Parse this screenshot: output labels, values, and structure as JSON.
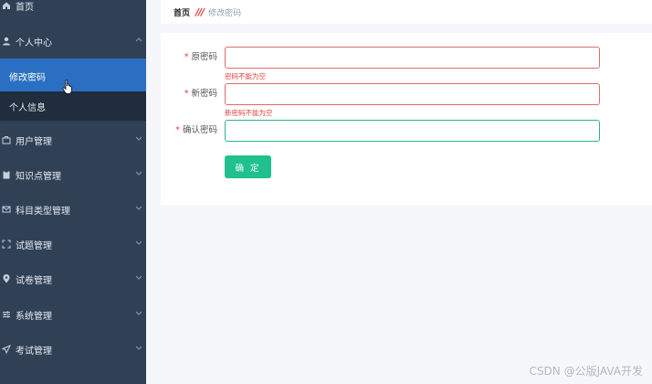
{
  "sidebar": {
    "items": [
      {
        "label": "首页",
        "icon": "home-icon"
      },
      {
        "label": "个人中心",
        "icon": "user-icon",
        "expanded": true
      },
      {
        "label": "修改密码",
        "sub": true,
        "active": true
      },
      {
        "label": "个人信息",
        "sub": true
      },
      {
        "label": "用户管理",
        "icon": "briefcase-icon"
      },
      {
        "label": "知识点管理",
        "icon": "clipboard-icon"
      },
      {
        "label": "科目类型管理",
        "icon": "mail-icon"
      },
      {
        "label": "试题管理",
        "icon": "expand-icon"
      },
      {
        "label": "试卷管理",
        "icon": "location-icon"
      },
      {
        "label": "系统管理",
        "icon": "sliders-icon"
      },
      {
        "label": "考试管理",
        "icon": "send-icon"
      }
    ]
  },
  "breadcrumb": {
    "home": "首页",
    "current": "修改密码"
  },
  "form": {
    "old_password": {
      "label": "原密码",
      "value": "",
      "error": "密码不能为空"
    },
    "new_password": {
      "label": "新密码",
      "value": "",
      "error": "新密码不能为空"
    },
    "confirm_password": {
      "label": "确认密码",
      "value": ""
    },
    "submit_label": "确 定"
  },
  "watermark": "CSDN @公版JAVA开发",
  "colors": {
    "sidebar_bg": "#304156",
    "submenu_bg": "#1f2d3d",
    "active_bg": "#2b6fc2",
    "primary_button": "#20c18d",
    "error": "#e0413b",
    "success_border": "#2db38f"
  }
}
